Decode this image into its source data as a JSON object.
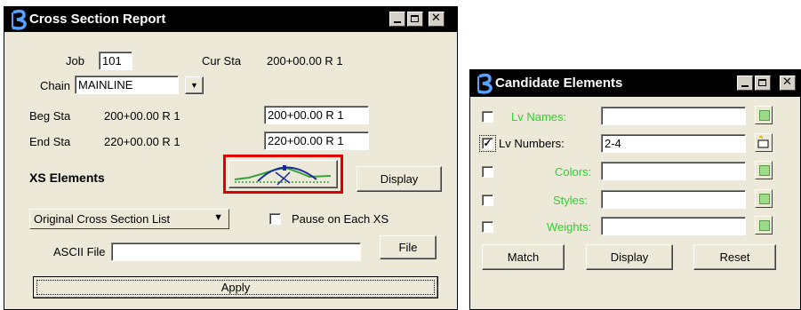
{
  "xs_window": {
    "title": "Cross Section Report",
    "job_label": "Job",
    "job_value": "101",
    "cur_sta_label": "Cur Sta",
    "cur_sta_value": "200+00.00 R 1",
    "chain_label": "Chain",
    "chain_value": "MAINLINE",
    "beg_sta_label": "Beg Sta",
    "beg_sta_value": "200+00.00 R 1",
    "beg_sta_field": "200+00.00 R 1",
    "end_sta_label": "End Sta",
    "end_sta_value": "220+00.00 R 1",
    "end_sta_field": "220+00.00 R 1",
    "xs_elements_label": "XS Elements",
    "display_label": "Display",
    "list_value": "Original Cross Section List",
    "pause_label": "Pause on Each XS",
    "ascii_label": "ASCII File",
    "ascii_value": "",
    "file_label": "File",
    "apply_label": "Apply",
    "highlight_color": "#e00000"
  },
  "cand_window": {
    "title": "Candidate Elements",
    "rows": [
      {
        "label": "Lv Names:",
        "value": "",
        "checked": false,
        "active": false
      },
      {
        "label": "Lv Numbers:",
        "value": "2-4",
        "checked": true,
        "active": true
      },
      {
        "label": "Colors:",
        "value": "",
        "checked": false,
        "active": false
      },
      {
        "label": "Styles:",
        "value": "",
        "checked": false,
        "active": false
      },
      {
        "label": "Weights:",
        "value": "",
        "checked": false,
        "active": false
      }
    ],
    "match_label": "Match",
    "display_label": "Display",
    "reset_label": "Reset",
    "disabled_label_color": "#2fcf2f"
  }
}
